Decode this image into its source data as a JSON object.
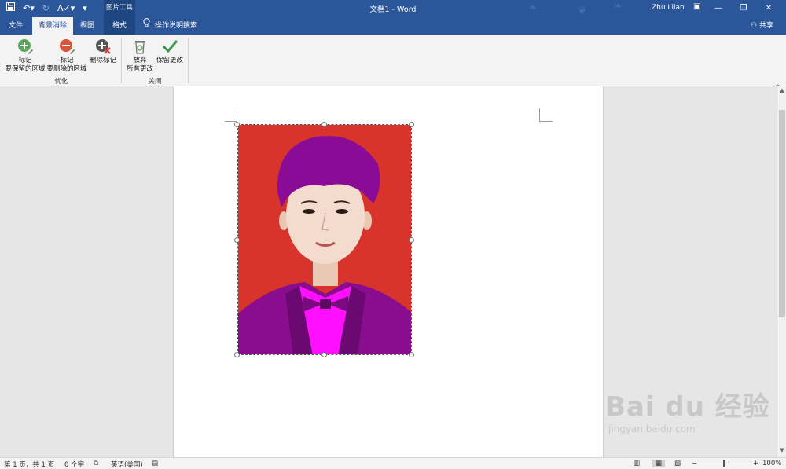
{
  "titlebar": {
    "doc_title": "文档1 - Word",
    "picture_tools": "图片工具",
    "user": "Zhu Lilan",
    "accent": "#2b579a"
  },
  "tabs": {
    "file": "文件",
    "background_removal": "背景消除",
    "view": "视图",
    "format": "格式",
    "tell_me": "操作说明搜索",
    "share": "共享"
  },
  "ribbon": {
    "mark_keep_line1": "标记",
    "mark_keep_line2": "要保留的区域",
    "mark_remove_line1": "标记",
    "mark_remove_line2": "要删除的区域",
    "delete_mark": "删除标记",
    "discard_line1": "放弃",
    "discard_line2": "所有更改",
    "keep_changes": "保留更改",
    "group_refine": "优化",
    "group_close": "关闭"
  },
  "statusbar": {
    "page": "第 1 页，共 1 页",
    "words": "0 个字",
    "language": "英语(美国)",
    "zoom": "100%"
  },
  "watermark": {
    "brand": "Bai du 经验",
    "url": "jingyan.baidu.com"
  },
  "icons": {
    "save": "save-icon",
    "undo": "undo-icon",
    "redo": "redo-icon",
    "lightbulb": "lightbulb-icon",
    "person": "person-icon"
  }
}
